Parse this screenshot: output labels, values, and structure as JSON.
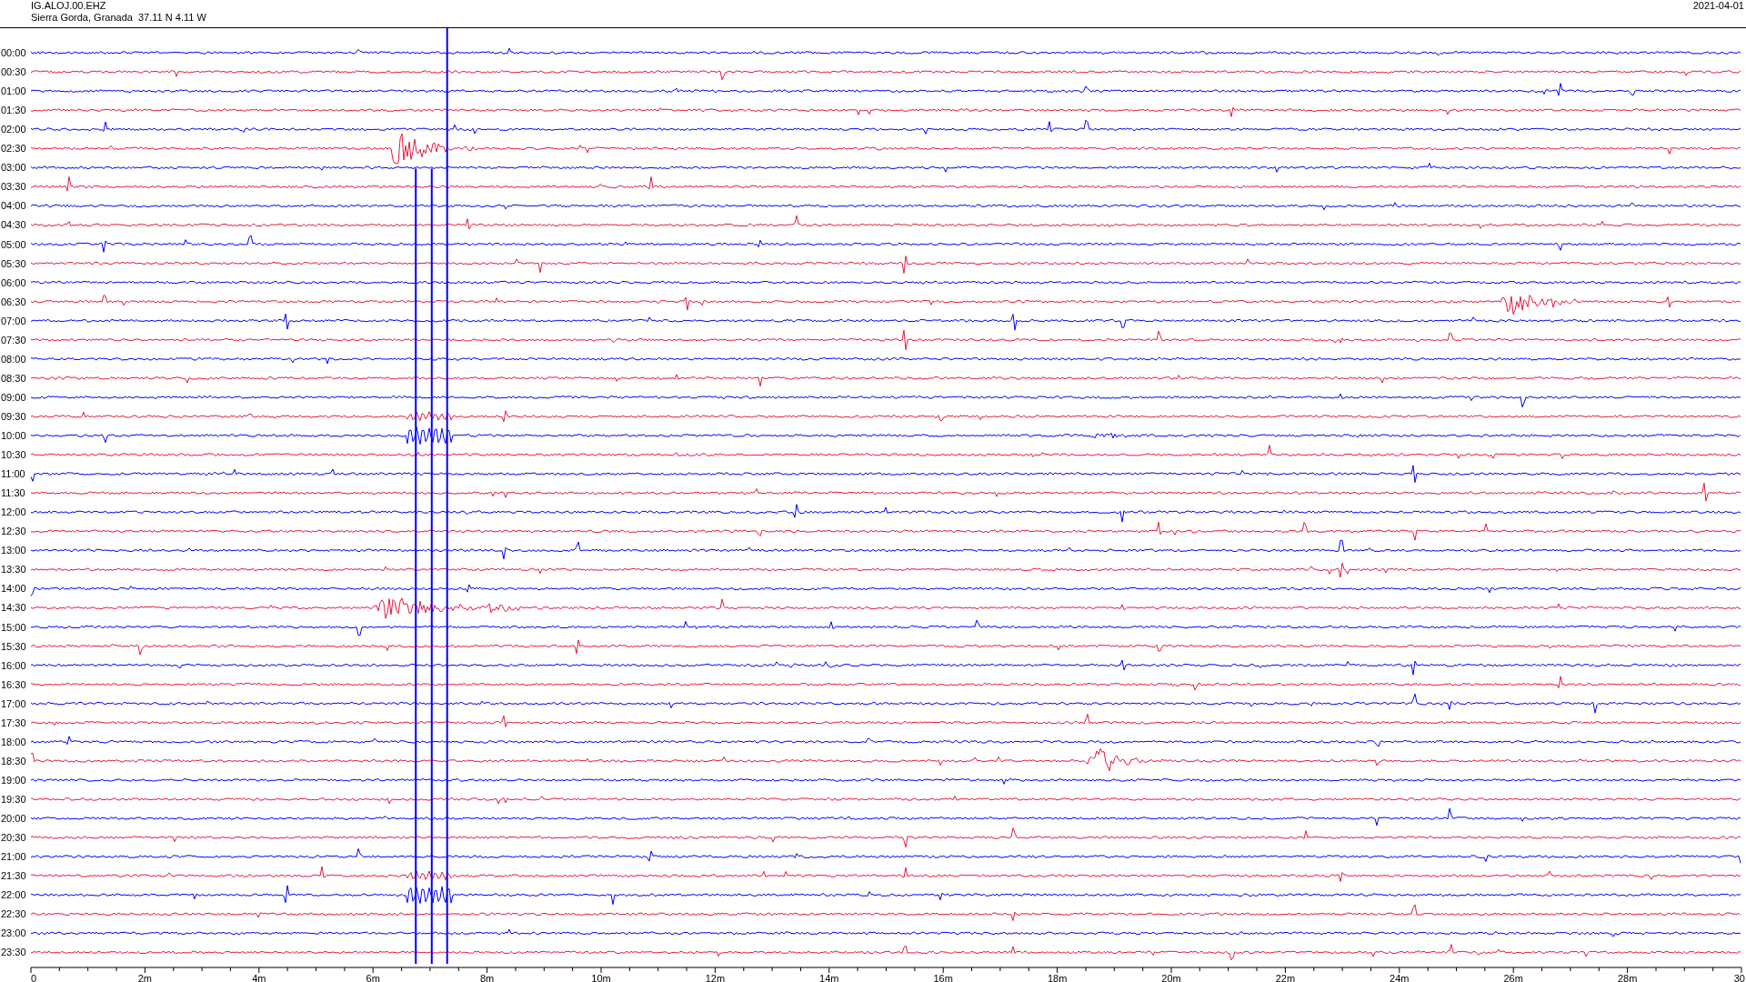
{
  "header": {
    "station": "IG.ALOJ.00.EHZ",
    "location": "Sierra Gorda, Granada  37.11 N 4.11 W",
    "date": "2021-04-01"
  },
  "rows": [
    {
      "time": "00:00",
      "color": "#0000ff"
    },
    {
      "time": "00:30",
      "color": "#e6193c"
    },
    {
      "time": "01:00",
      "color": "#0000ff"
    },
    {
      "time": "01:30",
      "color": "#e6193c"
    },
    {
      "time": "02:00",
      "color": "#0000ff"
    },
    {
      "time": "02:30",
      "color": "#e6193c"
    },
    {
      "time": "03:00",
      "color": "#0000ff"
    },
    {
      "time": "03:30",
      "color": "#e6193c"
    },
    {
      "time": "04:00",
      "color": "#0000ff"
    },
    {
      "time": "04:30",
      "color": "#e6193c"
    },
    {
      "time": "05:00",
      "color": "#0000ff"
    },
    {
      "time": "05:30",
      "color": "#e6193c"
    },
    {
      "time": "06:00",
      "color": "#0000ff"
    },
    {
      "time": "06:30",
      "color": "#e6193c"
    },
    {
      "time": "07:00",
      "color": "#0000ff"
    },
    {
      "time": "07:30",
      "color": "#e6193c"
    },
    {
      "time": "08:00",
      "color": "#0000ff"
    },
    {
      "time": "08:30",
      "color": "#e6193c"
    },
    {
      "time": "09:00",
      "color": "#0000ff"
    },
    {
      "time": "09:30",
      "color": "#e6193c"
    },
    {
      "time": "10:00",
      "color": "#0000ff"
    },
    {
      "time": "10:30",
      "color": "#e6193c"
    },
    {
      "time": "11:00",
      "color": "#0000ff"
    },
    {
      "time": "11:30",
      "color": "#e6193c"
    },
    {
      "time": "12:00",
      "color": "#0000ff"
    },
    {
      "time": "12:30",
      "color": "#e6193c"
    },
    {
      "time": "13:00",
      "color": "#0000ff"
    },
    {
      "time": "13:30",
      "color": "#e6193c"
    },
    {
      "time": "14:00",
      "color": "#0000ff"
    },
    {
      "time": "14:30",
      "color": "#e6193c"
    },
    {
      "time": "15:00",
      "color": "#0000ff"
    },
    {
      "time": "15:30",
      "color": "#e6193c"
    },
    {
      "time": "16:00",
      "color": "#0000ff"
    },
    {
      "time": "16:30",
      "color": "#e6193c"
    },
    {
      "time": "17:00",
      "color": "#0000ff"
    },
    {
      "time": "17:30",
      "color": "#e6193c"
    },
    {
      "time": "18:00",
      "color": "#0000ff"
    },
    {
      "time": "18:30",
      "color": "#e6193c"
    },
    {
      "time": "19:00",
      "color": "#0000ff"
    },
    {
      "time": "19:30",
      "color": "#e6193c"
    },
    {
      "time": "20:00",
      "color": "#0000ff"
    },
    {
      "time": "20:30",
      "color": "#e6193c"
    },
    {
      "time": "21:00",
      "color": "#0000ff"
    },
    {
      "time": "21:30",
      "color": "#e6193c"
    },
    {
      "time": "22:00",
      "color": "#0000ff"
    },
    {
      "time": "22:30",
      "color": "#e6193c"
    },
    {
      "time": "23:00",
      "color": "#0000ff"
    },
    {
      "time": "23:30",
      "color": "#e6193c"
    }
  ],
  "x_axis": {
    "labels": [
      "0",
      "2m",
      "4m",
      "6m",
      "8m",
      "10m",
      "12m",
      "14m",
      "16m",
      "18m",
      "20m",
      "22m",
      "24m",
      "26m",
      "28m",
      "30"
    ]
  }
}
